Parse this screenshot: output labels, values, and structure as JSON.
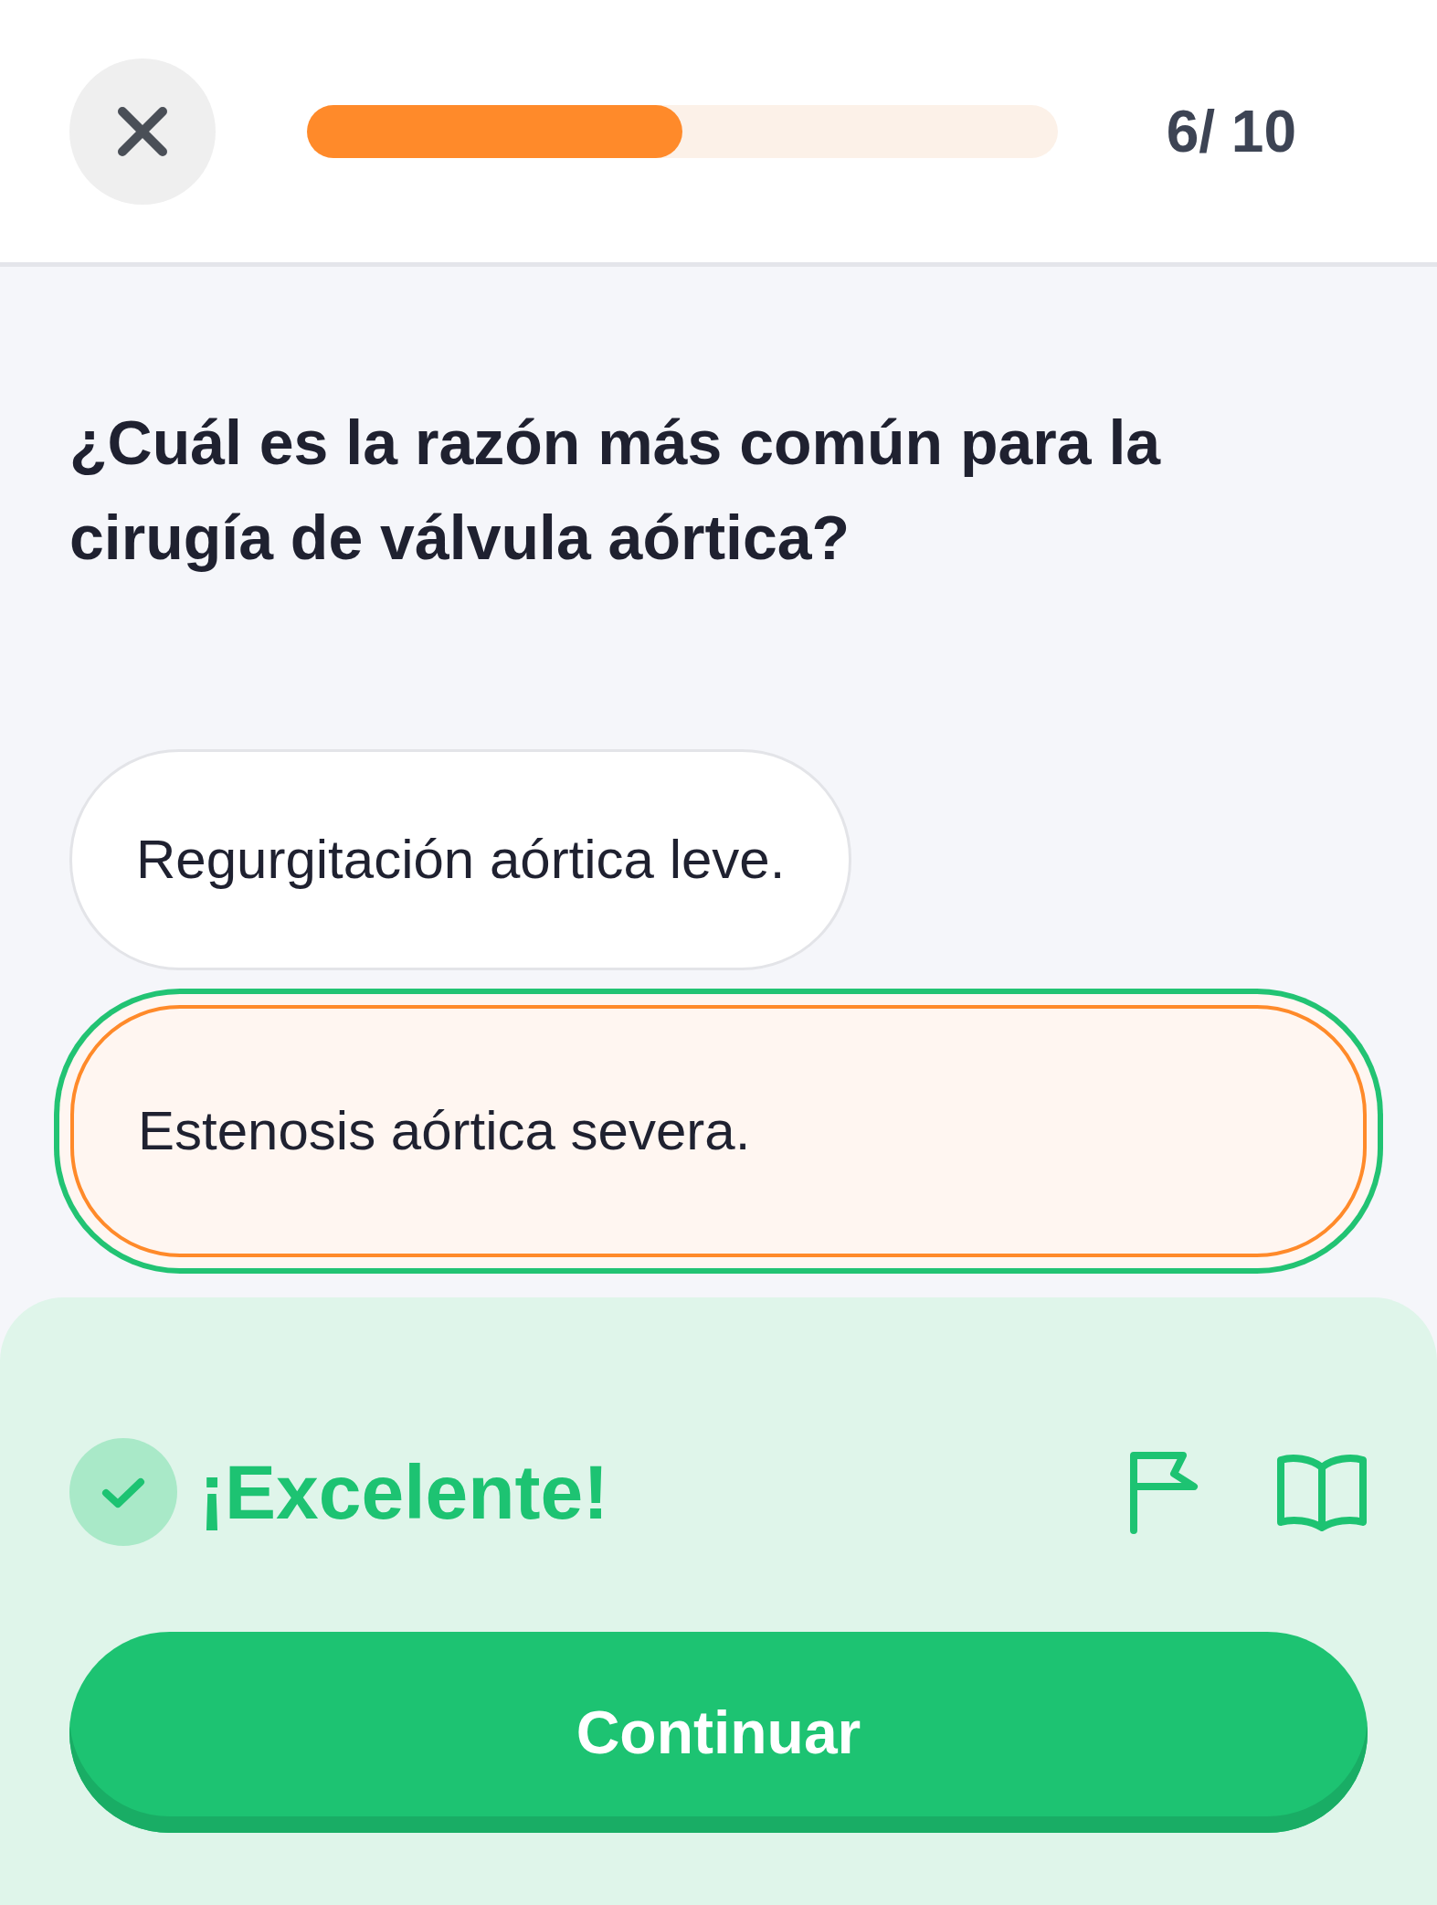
{
  "header": {
    "progress": {
      "level": 0.5
    },
    "counter": "6/ 10"
  },
  "question": "¿Cuál es la razón más común para la cirugía de válvula aórtica?",
  "options": [
    {
      "text": "Regurgitación aórtica leve.",
      "selected": false
    },
    {
      "text": "Estenosis aórtica severa.",
      "selected": true
    }
  ],
  "feedback": {
    "kind": "correct",
    "message": "¡Excelente!"
  },
  "continue_button": "Continuar"
}
